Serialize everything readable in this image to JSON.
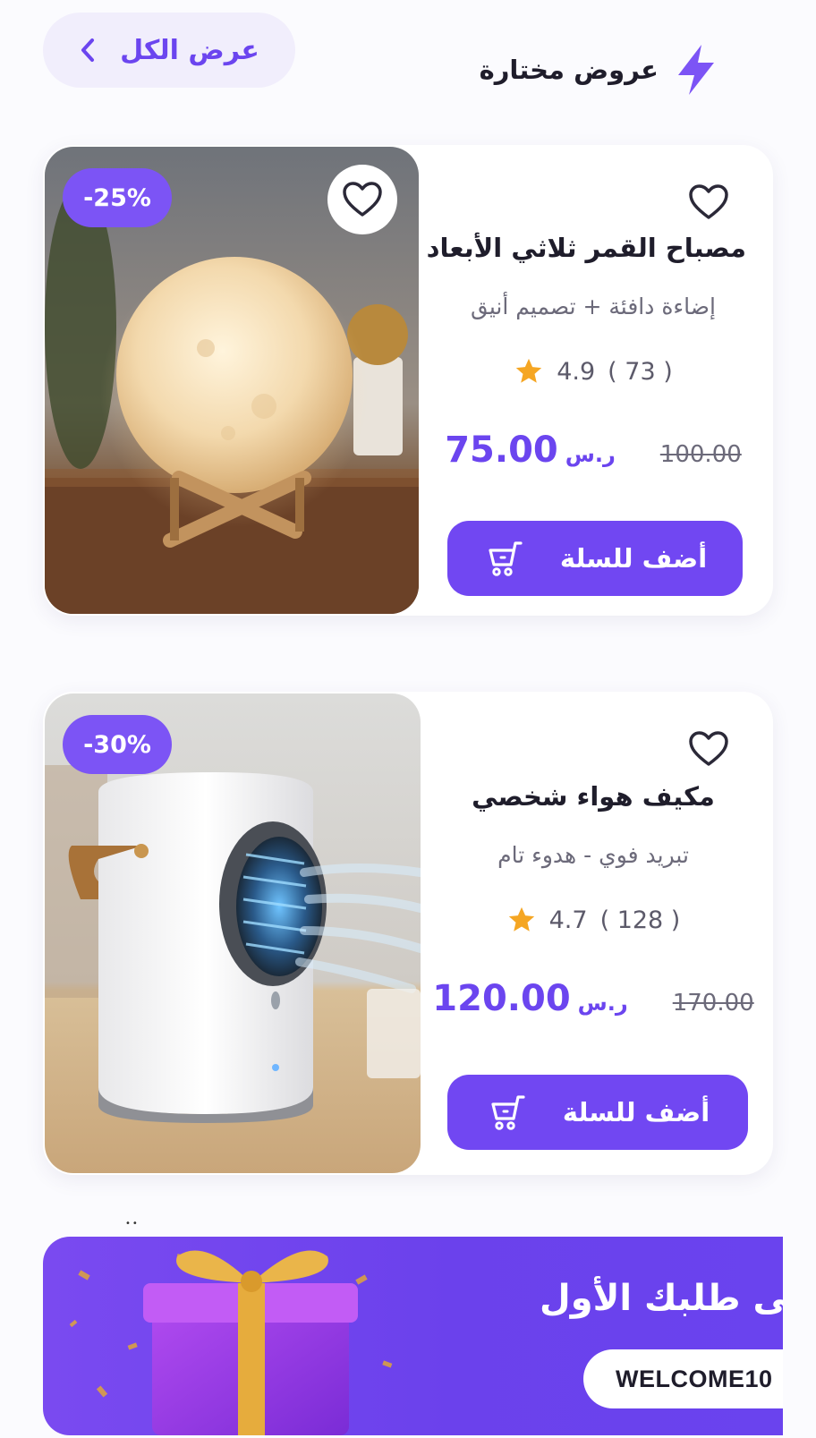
{
  "header": {
    "title": "عروض مختارة",
    "view_all_label": "عرض الكل",
    "accent": "#7c54f5"
  },
  "products": [
    {
      "name": "مصباح القمر ثلاثي الأبعاد",
      "subtitle": "إضاءة دافئة + تصميم أنيق",
      "discount": "-25%",
      "rating": "4.9",
      "reviews": "( 73 )",
      "price": "75.00",
      "currency": "ر.س",
      "old_price": "100.00",
      "cta": "أضف للسلة"
    },
    {
      "name": "مكيف هواء شخصي",
      "subtitle": "تبريد فوي - هدوء تام",
      "discount": "-30%",
      "rating": "4.7",
      "reviews": "( 128 )",
      "price": "120.00",
      "currency": "ر.س",
      "old_price": "170.00",
      "cta": "أضف للسلة"
    }
  ],
  "banner": {
    "title": "لى طلبك الأول",
    "coupon_code": "WELCOME10"
  },
  "icons": {
    "section": "lightning-bolt-icon",
    "view_all": "chevron-left-icon",
    "favorite": "heart-outline-icon",
    "rating": "star-icon",
    "cart": "shopping-cart-icon"
  },
  "colors": {
    "primary": "#7147f2",
    "star": "#f5a623",
    "text": "#1f1d2b",
    "muted": "#6c6a7a"
  }
}
